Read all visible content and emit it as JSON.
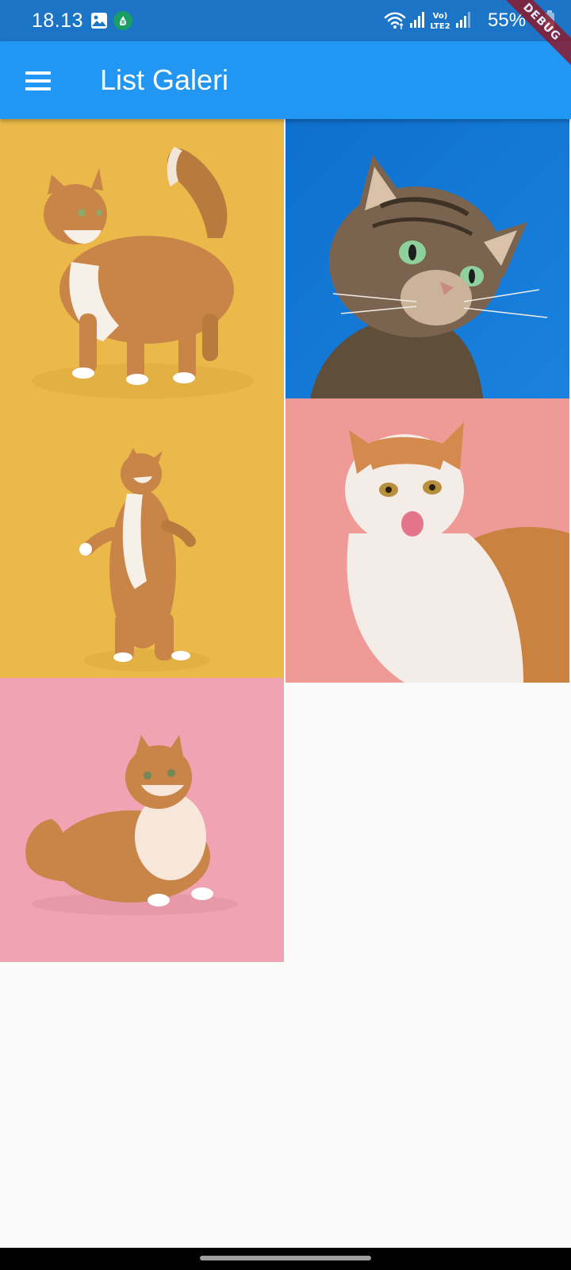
{
  "status_bar": {
    "time": "18.13",
    "battery": "55%",
    "network_label": "LTE2",
    "volte_label": "Vo)",
    "icons": [
      "image-notification-icon",
      "app-notification-icon",
      "wifi-icon",
      "signal-icon",
      "volte-lte2-icon",
      "signal-icon-2",
      "battery-icon"
    ],
    "background": "#1c74c6"
  },
  "debug_banner": {
    "label": "DEBUG"
  },
  "app_bar": {
    "title": "List Galeri",
    "menu_icon": "hamburger-menu-icon",
    "background": "#2196f3"
  },
  "gallery": {
    "items": [
      {
        "description": "orange cat standing, tail up",
        "background": "#eab949"
      },
      {
        "description": "tabby cat looking up",
        "background": "#1677d2"
      },
      {
        "description": "orange cat standing on hind legs",
        "background": "#eab949"
      },
      {
        "description": "orange and white cat licking lips",
        "background": "#f09a98"
      },
      {
        "description": "fluffy orange cat sitting",
        "background": "#f0a3b3"
      }
    ]
  },
  "nav_bar": {
    "handle": "home-gesture-handle"
  }
}
